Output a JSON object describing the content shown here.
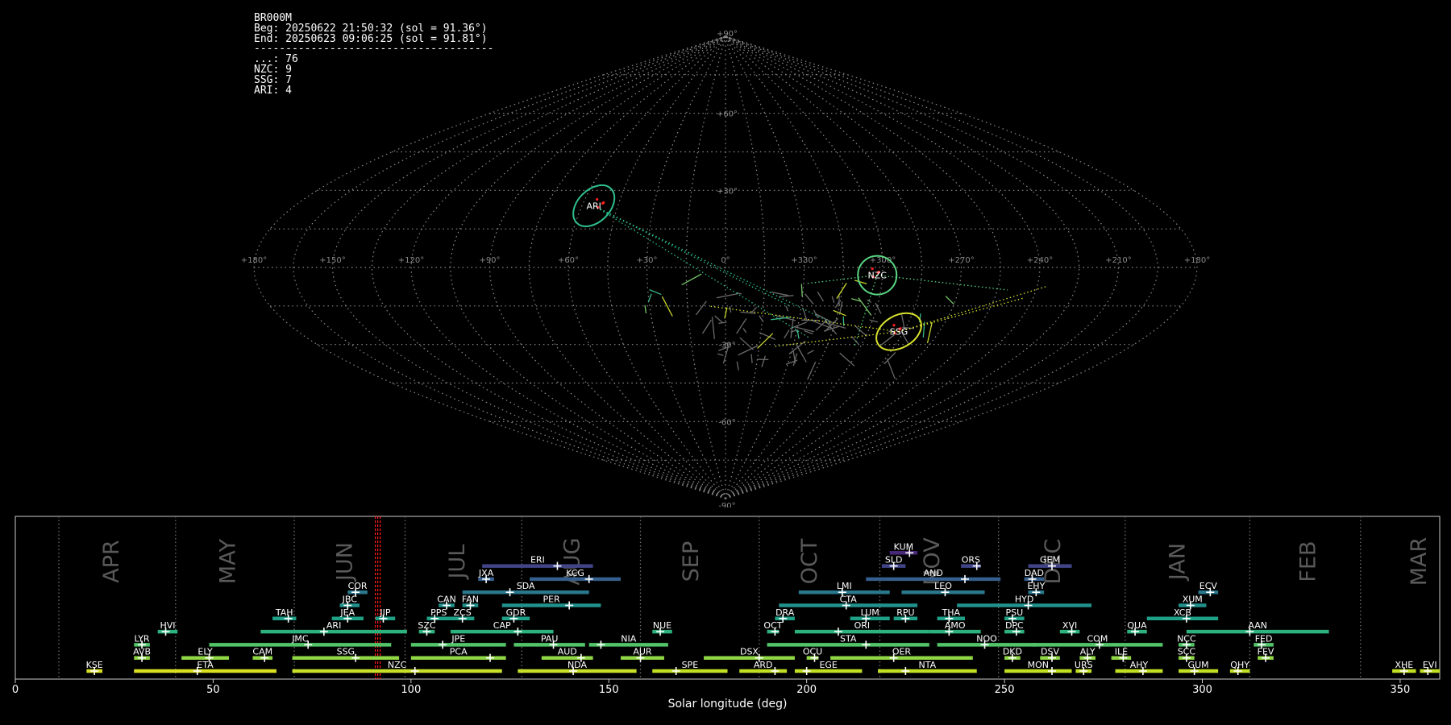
{
  "info": {
    "station": "BR000M",
    "begin": "Beg: 20250622 21:50:32 (sol = 91.36°)",
    "end": "End: 20250623 09:06:25 (sol = 91.81°)",
    "separator": "--------------------------------------",
    "counts": [
      "...: 76",
      "NZC: 9",
      "SSG: 7",
      "ARI: 4"
    ]
  },
  "colors": {
    "background": "#000000",
    "grid": "#8a8a8a",
    "red_marker": "#ff2020"
  },
  "chart_data": [
    {
      "type": "scatter",
      "projection": "sinusoidal",
      "lon_labels": [
        "+180°",
        "+150°",
        "+120°",
        "+90°",
        "+60°",
        "+30°",
        "0°",
        "+330°",
        "+300°",
        "+270°",
        "+240°",
        "+210°",
        "+180°"
      ],
      "lat_labels": [
        "+90°",
        "+60°",
        "+30°",
        "0°",
        "-30°",
        "-60°",
        "-90°"
      ],
      "lat_label_values": [
        90,
        60,
        30,
        0,
        -30,
        -60,
        -90
      ],
      "radiants": [
        {
          "name": "ARI",
          "color": "#2fbf8f",
          "lon_deg": 55,
          "lat_deg": 24
        },
        {
          "name": "NZC",
          "color": "#59d683",
          "lon_deg": 302,
          "lat_deg": -3
        },
        {
          "name": "SSG",
          "color": "#d7e12b",
          "lon_deg": 287,
          "lat_deg": -25
        }
      ]
    },
    {
      "type": "bar",
      "xlabel": "Solar longitude (deg)",
      "xlim": [
        0,
        360
      ],
      "xticks": [
        0,
        50,
        100,
        150,
        200,
        250,
        300,
        350
      ],
      "current_sol": 91.6,
      "months": [
        {
          "name": "APR",
          "center": 24.5,
          "boundary": 11
        },
        {
          "name": "MAY",
          "center": 54,
          "boundary": 40.5
        },
        {
          "name": "JUN",
          "center": 83.5,
          "boundary": 70.5
        },
        {
          "name": "JUL",
          "center": 112,
          "boundary": 98.5
        },
        {
          "name": "AUG",
          "center": 141,
          "boundary": 128
        },
        {
          "name": "SEP",
          "center": 171,
          "boundary": 158
        },
        {
          "name": "OCT",
          "center": 201,
          "boundary": 188
        },
        {
          "name": "NOV",
          "center": 232,
          "boundary": 218.5
        },
        {
          "name": "DEC",
          "center": 262.5,
          "boundary": 248.5
        },
        {
          "name": "JAN",
          "center": 294,
          "boundary": 280.5
        },
        {
          "name": "FEB",
          "center": 327,
          "boundary": 312
        },
        {
          "name": "MAR",
          "center": 355,
          "boundary": 340
        }
      ],
      "showers": [
        {
          "code": "KSE",
          "start": 18,
          "end": 22,
          "peak": 20,
          "row": 0,
          "color": "#d9e021"
        },
        {
          "code": "ETA",
          "start": 30,
          "end": 66,
          "peak": 46,
          "row": 0,
          "color": "#d9e021"
        },
        {
          "code": "NZC",
          "start": 70,
          "end": 123,
          "peak": 101,
          "row": 0,
          "color": "#c9e02a"
        },
        {
          "code": "NDA",
          "start": 127,
          "end": 157,
          "peak": 141,
          "row": 0,
          "color": "#c9e02a"
        },
        {
          "code": "SPE",
          "start": 161,
          "end": 180,
          "peak": 167,
          "row": 0,
          "color": "#c2df23"
        },
        {
          "code": "ARD",
          "start": 183,
          "end": 195,
          "peak": 192,
          "row": 0,
          "color": "#c2df23"
        },
        {
          "code": "EGE",
          "start": 197,
          "end": 214,
          "peak": 200,
          "row": 0,
          "color": "#c2df23"
        },
        {
          "code": "NTA",
          "start": 218,
          "end": 243,
          "peak": 225,
          "row": 0,
          "color": "#c2df23"
        },
        {
          "code": "MON",
          "start": 250,
          "end": 267,
          "peak": 262,
          "row": 0,
          "color": "#c2df23"
        },
        {
          "code": "URS",
          "start": 268,
          "end": 272,
          "peak": 270,
          "row": 0,
          "color": "#c2df23"
        },
        {
          "code": "AHY",
          "start": 278,
          "end": 290,
          "peak": 285,
          "row": 0,
          "color": "#c2df23"
        },
        {
          "code": "GUM",
          "start": 294,
          "end": 304,
          "peak": 298,
          "row": 0,
          "color": "#c2df23"
        },
        {
          "code": "QHY",
          "start": 307,
          "end": 312,
          "peak": 309,
          "row": 0,
          "color": "#c2df23"
        },
        {
          "code": "XHE",
          "start": 348,
          "end": 354,
          "peak": 351,
          "row": 0,
          "color": "#c2df23"
        },
        {
          "code": "EVI",
          "start": 355,
          "end": 360,
          "peak": 357,
          "row": 0,
          "color": "#c2df23"
        },
        {
          "code": "AVB",
          "start": 30,
          "end": 34,
          "peak": 32,
          "row": 1,
          "color": "#8fd744"
        },
        {
          "code": "ELY",
          "start": 42,
          "end": 54,
          "peak": 49,
          "row": 1,
          "color": "#8fd744"
        },
        {
          "code": "CAM",
          "start": 60,
          "end": 65,
          "peak": 63,
          "row": 1,
          "color": "#8fd744"
        },
        {
          "code": "SSG",
          "start": 70,
          "end": 97,
          "peak": 86,
          "row": 1,
          "color": "#8fd744"
        },
        {
          "code": "PCA",
          "start": 100,
          "end": 124,
          "peak": 120,
          "row": 1,
          "color": "#8fd744"
        },
        {
          "code": "AUD",
          "start": 133,
          "end": 146,
          "peak": 143,
          "row": 1,
          "color": "#8fd744"
        },
        {
          "code": "AUR",
          "start": 153,
          "end": 164,
          "peak": 158,
          "row": 1,
          "color": "#8fd744"
        },
        {
          "code": "DSX",
          "start": 174,
          "end": 197,
          "peak": 188,
          "row": 1,
          "color": "#8fd744"
        },
        {
          "code": "OCU",
          "start": 200,
          "end": 203,
          "peak": 202,
          "row": 1,
          "color": "#8fd744"
        },
        {
          "code": "OER",
          "start": 206,
          "end": 242,
          "peak": 222,
          "row": 1,
          "color": "#8fd744"
        },
        {
          "code": "DKD",
          "start": 250,
          "end": 254,
          "peak": 252,
          "row": 1,
          "color": "#8fd744"
        },
        {
          "code": "DSV",
          "start": 259,
          "end": 264,
          "peak": 262,
          "row": 1,
          "color": "#8fd744"
        },
        {
          "code": "ALY",
          "start": 269,
          "end": 273,
          "peak": 271,
          "row": 1,
          "color": "#8fd744"
        },
        {
          "code": "ILE",
          "start": 277,
          "end": 282,
          "peak": 280,
          "row": 1,
          "color": "#8fd744"
        },
        {
          "code": "SCC",
          "start": 294,
          "end": 298,
          "peak": 296,
          "row": 1,
          "color": "#8fd744"
        },
        {
          "code": "FEV",
          "start": 314,
          "end": 318,
          "peak": 316,
          "row": 1,
          "color": "#8fd744"
        },
        {
          "code": "LYR",
          "start": 30,
          "end": 34,
          "peak": 32,
          "row": 2,
          "color": "#52c569"
        },
        {
          "code": "JMC",
          "start": 49,
          "end": 95,
          "peak": 74,
          "row": 2,
          "color": "#52c569"
        },
        {
          "code": "JPE",
          "start": 100,
          "end": 124,
          "peak": 108,
          "row": 2,
          "color": "#52c569"
        },
        {
          "code": "PAU",
          "start": 126,
          "end": 144,
          "peak": 136,
          "row": 2,
          "color": "#52c569"
        },
        {
          "code": "NIA",
          "start": 145,
          "end": 165,
          "peak": 148,
          "row": 2,
          "color": "#52c569"
        },
        {
          "code": "STA",
          "start": 190,
          "end": 231,
          "peak": 215,
          "row": 2,
          "color": "#52c569"
        },
        {
          "code": "NOO",
          "start": 233,
          "end": 258,
          "peak": 245,
          "row": 2,
          "color": "#52c569"
        },
        {
          "code": "COM",
          "start": 257,
          "end": 290,
          "peak": 274,
          "row": 2,
          "color": "#52c569"
        },
        {
          "code": "NCC",
          "start": 294,
          "end": 298,
          "peak": 296,
          "row": 2,
          "color": "#52c569"
        },
        {
          "code": "FED",
          "start": 313,
          "end": 318,
          "peak": 315,
          "row": 2,
          "color": "#52c569"
        },
        {
          "code": "HVI",
          "start": 36,
          "end": 41,
          "peak": 38,
          "row": 3,
          "color": "#2db27d"
        },
        {
          "code": "ARI",
          "start": 62,
          "end": 99,
          "peak": 78,
          "row": 3,
          "color": "#2db27d"
        },
        {
          "code": "SZC",
          "start": 102,
          "end": 106,
          "peak": 104,
          "row": 3,
          "color": "#2db27d"
        },
        {
          "code": "CAP",
          "start": 110,
          "end": 136,
          "peak": 127,
          "row": 3,
          "color": "#2db27d"
        },
        {
          "code": "NUE",
          "start": 161,
          "end": 166,
          "peak": 163,
          "row": 3,
          "color": "#2db27d"
        },
        {
          "code": "OCT",
          "start": 190,
          "end": 193,
          "peak": 192,
          "row": 3,
          "color": "#2db27d"
        },
        {
          "code": "ORI",
          "start": 197,
          "end": 231,
          "peak": 208,
          "row": 3,
          "color": "#2db27d"
        },
        {
          "code": "AMO",
          "start": 231,
          "end": 244,
          "peak": 236,
          "row": 3,
          "color": "#2db27d"
        },
        {
          "code": "DPC",
          "start": 250,
          "end": 255,
          "peak": 253,
          "row": 3,
          "color": "#2db27d"
        },
        {
          "code": "XVI",
          "start": 264,
          "end": 269,
          "peak": 267,
          "row": 3,
          "color": "#2db27d"
        },
        {
          "code": "QUA",
          "start": 281,
          "end": 286,
          "peak": 283,
          "row": 3,
          "color": "#2db27d"
        },
        {
          "code": "AAN",
          "start": 296,
          "end": 332,
          "peak": 312,
          "row": 3,
          "color": "#2db27d"
        },
        {
          "code": "TAH",
          "start": 65,
          "end": 71,
          "peak": 69,
          "row": 4,
          "color": "#1fa187"
        },
        {
          "code": "JEA",
          "start": 80,
          "end": 88,
          "peak": 84,
          "row": 4,
          "color": "#1fa187"
        },
        {
          "code": "JIP",
          "start": 91,
          "end": 96,
          "peak": 93,
          "row": 4,
          "color": "#1fa187"
        },
        {
          "code": "PPS",
          "start": 104,
          "end": 110,
          "peak": 106,
          "row": 4,
          "color": "#1fa187"
        },
        {
          "code": "ZCS",
          "start": 110,
          "end": 116,
          "peak": 113,
          "row": 4,
          "color": "#1fa187"
        },
        {
          "code": "GDR",
          "start": 123,
          "end": 130,
          "peak": 126,
          "row": 4,
          "color": "#1fa187"
        },
        {
          "code": "DRA",
          "start": 192,
          "end": 197,
          "peak": 194,
          "row": 4,
          "color": "#1fa187"
        },
        {
          "code": "LUM",
          "start": 211,
          "end": 221,
          "peak": 215,
          "row": 4,
          "color": "#1fa187"
        },
        {
          "code": "RPU",
          "start": 222,
          "end": 228,
          "peak": 225,
          "row": 4,
          "color": "#1fa187"
        },
        {
          "code": "THA",
          "start": 233,
          "end": 240,
          "peak": 236,
          "row": 4,
          "color": "#1fa187"
        },
        {
          "code": "PSU",
          "start": 250,
          "end": 255,
          "peak": 252,
          "row": 4,
          "color": "#1fa187"
        },
        {
          "code": "XCB",
          "start": 286,
          "end": 304,
          "peak": 296,
          "row": 4,
          "color": "#1fa187"
        },
        {
          "code": "JBC",
          "start": 82,
          "end": 87,
          "peak": 84,
          "row": 5,
          "color": "#21918c"
        },
        {
          "code": "CAN",
          "start": 107,
          "end": 111,
          "peak": 109,
          "row": 5,
          "color": "#21918c"
        },
        {
          "code": "FAN",
          "start": 113,
          "end": 117,
          "peak": 115,
          "row": 5,
          "color": "#21918c"
        },
        {
          "code": "PER",
          "start": 123,
          "end": 148,
          "peak": 140,
          "row": 5,
          "color": "#21918c"
        },
        {
          "code": "CTA",
          "start": 193,
          "end": 228,
          "peak": 210,
          "row": 5,
          "color": "#21918c"
        },
        {
          "code": "HYD",
          "start": 238,
          "end": 272,
          "peak": 256,
          "row": 5,
          "color": "#21918c"
        },
        {
          "code": "XUM",
          "start": 294,
          "end": 301,
          "peak": 297,
          "row": 5,
          "color": "#21918c"
        },
        {
          "code": "COR",
          "start": 84,
          "end": 89,
          "peak": 86,
          "row": 6,
          "color": "#2a788e"
        },
        {
          "code": "SDA",
          "start": 113,
          "end": 145,
          "peak": 125,
          "row": 6,
          "color": "#2a788e"
        },
        {
          "code": "LMI",
          "start": 198,
          "end": 221,
          "peak": 209,
          "row": 6,
          "color": "#2a788e"
        },
        {
          "code": "LEO",
          "start": 224,
          "end": 245,
          "peak": 235,
          "row": 6,
          "color": "#2a788e"
        },
        {
          "code": "EHY",
          "start": 256,
          "end": 260,
          "peak": 258,
          "row": 6,
          "color": "#2a788e"
        },
        {
          "code": "ECV",
          "start": 299,
          "end": 304,
          "peak": 302,
          "row": 6,
          "color": "#2a788e"
        },
        {
          "code": "JXA",
          "start": 117,
          "end": 121,
          "peak": 119,
          "row": 7,
          "color": "#355f8d"
        },
        {
          "code": "KCG",
          "start": 130,
          "end": 153,
          "peak": 145,
          "row": 7,
          "color": "#355f8d"
        },
        {
          "code": "AND",
          "start": 215,
          "end": 249,
          "peak": 240,
          "row": 7,
          "color": "#355f8d"
        },
        {
          "code": "DAD",
          "start": 255,
          "end": 260,
          "peak": 257,
          "row": 7,
          "color": "#355f8d"
        },
        {
          "code": "ERI",
          "start": 118,
          "end": 146,
          "peak": 137,
          "row": 8,
          "color": "#414487"
        },
        {
          "code": "SLD",
          "start": 219,
          "end": 225,
          "peak": 222,
          "row": 8,
          "color": "#414487"
        },
        {
          "code": "ORS",
          "start": 239,
          "end": 244,
          "peak": 243,
          "row": 8,
          "color": "#414487"
        },
        {
          "code": "GEM",
          "start": 256,
          "end": 267,
          "peak": 262,
          "row": 8,
          "color": "#414487"
        },
        {
          "code": "KUM",
          "start": 221,
          "end": 228,
          "peak": 226,
          "row": 9,
          "color": "#482878"
        }
      ]
    }
  ]
}
